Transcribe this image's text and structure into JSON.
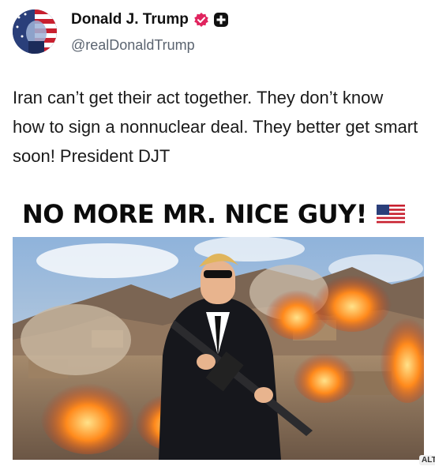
{
  "post": {
    "author_name": "Donald J. Trump",
    "handle": "@realDonaldTrump",
    "text": "Iran can’t get their act together. They don’t know how to sign a nonnuclear deal. They better get smart soon! President DJT"
  },
  "media": {
    "headline": "NO MORE MR. NICE GUY!",
    "alt_label": "ALT"
  },
  "icons": {
    "verified": "verified-badge-icon",
    "plus": "plus-badge-icon",
    "flag": "us-flag-icon"
  },
  "colors": {
    "verified": "#e0245e",
    "plus_badge": "#111111",
    "handle": "#5b6470"
  }
}
